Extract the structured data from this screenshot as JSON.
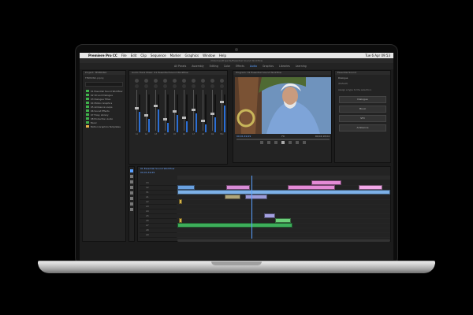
{
  "menubar": {
    "apple": "",
    "app_name": "Premiere Pro CC",
    "items": [
      "File",
      "Edit",
      "Clip",
      "Sequence",
      "Marker",
      "Graphics",
      "Window",
      "Help"
    ],
    "clock": "Tue 6 Apr  09:53"
  },
  "window_title": "/Volumes/Projects/Essential Sound Workflow",
  "workspaces": [
    "All Panels",
    "Assembly",
    "Editing",
    "Color",
    "Effects",
    "Audio",
    "Graphics",
    "Libraries",
    "Learning"
  ],
  "active_workspace": "Audio",
  "project": {
    "header": "Project: TESMUSIC",
    "bin": "TESMUSIC.prproj",
    "items": [
      {
        "label": "01 Essential Sound Workflow",
        "color": "#3fb24b"
      },
      {
        "label": "02 VO and Dialogue",
        "color": "#3fb24b"
      },
      {
        "label": "03 Dialogue Titles",
        "color": "#3fb24b"
      },
      {
        "label": "04 Motion Graphics",
        "color": "#3fb24b"
      },
      {
        "label": "05 Ambience Loops",
        "color": "#3fb24b"
      },
      {
        "label": "06 Sound Effects",
        "color": "#3fb24b"
      },
      {
        "label": "07 Foley Library",
        "color": "#3fb24b"
      },
      {
        "label": "08 Production Audio",
        "color": "#3fb24b"
      },
      {
        "label": "Music",
        "color": "#3fb24b"
      },
      {
        "label": "Motion Graphics Templates",
        "color": "#e8b34a"
      }
    ]
  },
  "mixer": {
    "header": "Audio Track Mixer: 01 Essential Sound Workflow",
    "strips": [
      {
        "name": "A1",
        "level": 0.55
      },
      {
        "name": "A2",
        "level": 0.35
      },
      {
        "name": "A3",
        "level": 0.6
      },
      {
        "name": "A4",
        "level": 0.25
      },
      {
        "name": "A5",
        "level": 0.45
      },
      {
        "name": "A6",
        "level": 0.3
      },
      {
        "name": "A7",
        "level": 0.5
      },
      {
        "name": "A8",
        "level": 0.2
      },
      {
        "name": "A9",
        "level": 0.4
      },
      {
        "name": "Mix",
        "level": 0.7
      }
    ]
  },
  "source": {
    "header": "Audio Clip Mixer: 01 Essential Sound Workflow"
  },
  "program": {
    "header": "Program: 01 Essential Sound Workflow",
    "timecode": "00;01;49;29",
    "fit": "Fit",
    "duration": "00;04;18;04"
  },
  "essential_sound": {
    "header": "Essential Sound",
    "clip_label": "Dialogue",
    "preset": "(Default)",
    "types_label": "Assign a type to the selection:",
    "buttons": [
      "Dialogue",
      "Music",
      "SFX",
      "Ambience"
    ]
  },
  "timeline": {
    "tab": "01 Essential Sound Workflow",
    "timecode": "00;01;49;29",
    "tracks": [
      "V3",
      "V2",
      "V1",
      "A1",
      "A2",
      "A3",
      "A4",
      "A5",
      "A6",
      "A7",
      "A8",
      "A9"
    ]
  }
}
